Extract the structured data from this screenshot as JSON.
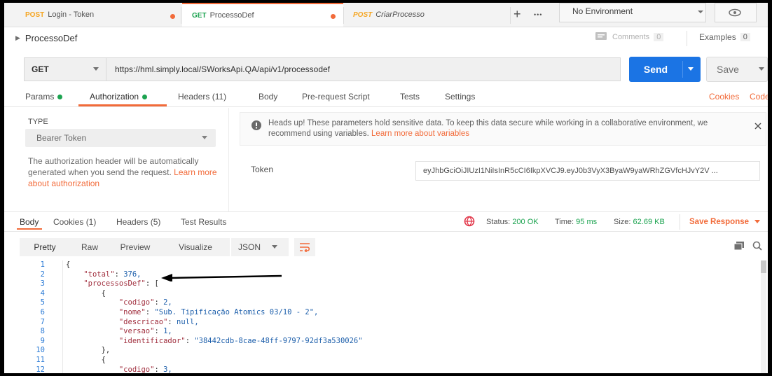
{
  "tabs": [
    {
      "method": "POST",
      "name": "Login - Token",
      "method_color": "#f5a623"
    },
    {
      "method": "GET",
      "name": "ProcessoDef",
      "method_color": "#1ca350"
    },
    {
      "method": "POST",
      "name": "CriarProcesso",
      "method_color": "#f5a623"
    }
  ],
  "tabbar": {
    "add": "+",
    "more": "•••"
  },
  "environment": {
    "label": "No Environment"
  },
  "request": {
    "title": "ProcessoDef",
    "comments": "Comments",
    "comments_count": "0",
    "examples": "Examples",
    "examples_count": "0"
  },
  "url": {
    "method": "GET",
    "value": "https://hml.simply.local/SWorksApi.QA/api/v1/processodef"
  },
  "buttons": {
    "send": "Send",
    "save": "Save"
  },
  "req_tabs": {
    "params": "Params",
    "authorization": "Authorization",
    "headers": "Headers (11)",
    "body": "Body",
    "prerequest": "Pre-request Script",
    "tests": "Tests",
    "settings": "Settings",
    "cookies": "Cookies",
    "code": "Code"
  },
  "auth": {
    "type_label": "TYPE",
    "type_value": "Bearer Token",
    "description": "The authorization header will be automatically generated when you send the request.",
    "learn_more": "Learn more about authorization",
    "notice_text": "Heads up! These parameters hold sensitive data. To keep this data secure while working in a collaborative environment, we recommend using variables.",
    "notice_link": "Learn more about variables",
    "token_label": "Token",
    "token_value": "eyJhbGciOiJIUzI1NiIsInR5cCI6IkpXVCJ9.eyJ0b3VyX3ByaW9yaWRhZGVfcHJvY2V ..."
  },
  "response": {
    "tabs": {
      "body": "Body",
      "cookies": "Cookies (1)",
      "headers": "Headers (5)",
      "test_results": "Test Results"
    },
    "status_label": "Status:",
    "status": "200 OK",
    "time_label": "Time:",
    "time": "95 ms",
    "size_label": "Size:",
    "size": "62.69 KB",
    "save_response": "Save Response"
  },
  "view": {
    "pretty": "Pretty",
    "raw": "Raw",
    "preview": "Preview",
    "visualize": "Visualize",
    "format": "JSON"
  },
  "code_lines": [
    {
      "n": "1",
      "indent": 0,
      "k": "",
      "v": "{",
      "vt": "p"
    },
    {
      "n": "2",
      "indent": 1,
      "k": "\"total\"",
      "v": " 376,",
      "vt": "n"
    },
    {
      "n": "3",
      "indent": 1,
      "k": "\"processosDef\"",
      "v": " [",
      "vt": "p"
    },
    {
      "n": "4",
      "indent": 2,
      "k": "",
      "v": "{",
      "vt": "p"
    },
    {
      "n": "5",
      "indent": 3,
      "k": "\"codigo\"",
      "v": " 2,",
      "vt": "n"
    },
    {
      "n": "6",
      "indent": 3,
      "k": "\"nome\"",
      "v": " \"Sub. Tipificação Atomics 03/10 - 2\",",
      "vt": "s"
    },
    {
      "n": "7",
      "indent": 3,
      "k": "\"descricao\"",
      "v": " null,",
      "vt": "n"
    },
    {
      "n": "8",
      "indent": 3,
      "k": "\"versao\"",
      "v": " 1,",
      "vt": "n"
    },
    {
      "n": "9",
      "indent": 3,
      "k": "\"identificador\"",
      "v": " \"38442cdb-8cae-48ff-9797-92df3a530026\"",
      "vt": "s"
    },
    {
      "n": "10",
      "indent": 2,
      "k": "",
      "v": "},",
      "vt": "p"
    },
    {
      "n": "11",
      "indent": 2,
      "k": "",
      "v": "{",
      "vt": "p"
    },
    {
      "n": "12",
      "indent": 3,
      "k": "\"codigo\"",
      "v": " 3,",
      "vt": "n"
    }
  ]
}
